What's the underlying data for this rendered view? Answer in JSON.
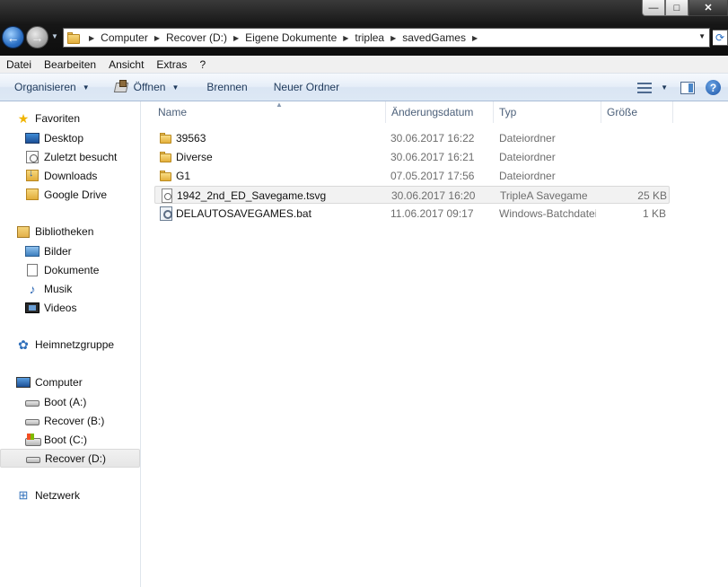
{
  "window": {
    "controls": {
      "minimize": "—",
      "maximize": "□",
      "close": "✕"
    }
  },
  "address": {
    "crumbs": [
      "Computer",
      "Recover (D:)",
      "Eigene Dokumente",
      "triplea",
      "savedGames"
    ]
  },
  "menu": [
    "Datei",
    "Bearbeiten",
    "Ansicht",
    "Extras",
    "?"
  ],
  "toolbar": {
    "organize": "Organisieren",
    "open": "Öffnen",
    "burn": "Brennen",
    "new_folder": "Neuer Ordner",
    "help": "?"
  },
  "nav": {
    "favorites": {
      "label": "Favoriten",
      "items": [
        "Desktop",
        "Zuletzt besucht",
        "Downloads",
        "Google Drive"
      ]
    },
    "libraries": {
      "label": "Bibliotheken",
      "items": [
        "Bilder",
        "Dokumente",
        "Musik",
        "Videos"
      ]
    },
    "homegroup": {
      "label": "Heimnetzgruppe"
    },
    "computer": {
      "label": "Computer",
      "items": [
        "Boot (A:)",
        "Recover (B:)",
        "Boot (C:)",
        "Recover (D:)"
      ],
      "selected": "Recover (D:)"
    },
    "network": {
      "label": "Netzwerk"
    }
  },
  "columns": {
    "name": "Name",
    "date": "Änderungsdatum",
    "type": "Typ",
    "size": "Größe"
  },
  "files": [
    {
      "name": "39563",
      "date": "30.06.2017 16:22",
      "type": "Dateiordner",
      "size": "",
      "icon": "folder-icon"
    },
    {
      "name": "Diverse",
      "date": "30.06.2017 16:21",
      "type": "Dateiordner",
      "size": "",
      "icon": "folder-icon"
    },
    {
      "name": "G1",
      "date": "07.05.2017 17:56",
      "type": "Dateiordner",
      "size": "",
      "icon": "folder-icon"
    },
    {
      "name": "1942_2nd_ED_Savegame.tsvg",
      "date": "30.06.2017 16:20",
      "type": "TripleA Savegame",
      "size": "25 KB",
      "icon": "document-icon"
    },
    {
      "name": "DELAUTOSAVEGAMES.bat",
      "date": "11.06.2017 09:17",
      "type": "Windows-Batchdatei",
      "size": "1 KB",
      "icon": "batch-file-icon"
    }
  ]
}
